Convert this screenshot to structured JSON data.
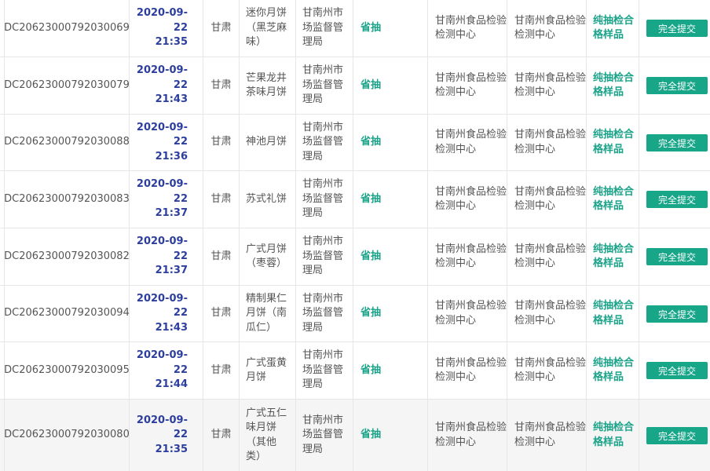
{
  "rows": [
    {
      "id": "DC20623000792030069",
      "date": "2020-09-22",
      "time": "21:35",
      "province": "甘肃",
      "food": "迷你月饼（黑芝麻味）",
      "agency": "甘南州市场监督管理局",
      "type": "省抽",
      "lab1": "甘南州食品检验检测中心",
      "lab2": "甘南州食品检验检测中心",
      "result": "纯抽检合格样品",
      "action": "完全提交"
    },
    {
      "id": "DC20623000792030079",
      "date": "2020-09-22",
      "time": "21:43",
      "province": "甘肃",
      "food": "芒果龙井茶味月饼",
      "agency": "甘南州市场监督管理局",
      "type": "省抽",
      "lab1": "甘南州食品检验检测中心",
      "lab2": "甘南州食品检验检测中心",
      "result": "纯抽检合格样品",
      "action": "完全提交"
    },
    {
      "id": "DC20623000792030088",
      "date": "2020-09-22",
      "time": "21:36",
      "province": "甘肃",
      "food": "神池月饼",
      "agency": "甘南州市场监督管理局",
      "type": "省抽",
      "lab1": "甘南州食品检验检测中心",
      "lab2": "甘南州食品检验检测中心",
      "result": "纯抽检合格样品",
      "action": "完全提交"
    },
    {
      "id": "DC20623000792030083",
      "date": "2020-09-22",
      "time": "21:37",
      "province": "甘肃",
      "food": "苏式礼饼",
      "agency": "甘南州市场监督管理局",
      "type": "省抽",
      "lab1": "甘南州食品检验检测中心",
      "lab2": "甘南州食品检验检测中心",
      "result": "纯抽检合格样品",
      "action": "完全提交"
    },
    {
      "id": "DC20623000792030082",
      "date": "2020-09-22",
      "time": "21:37",
      "province": "甘肃",
      "food": "广式月饼（枣蓉）",
      "agency": "甘南州市场监督管理局",
      "type": "省抽",
      "lab1": "甘南州食品检验检测中心",
      "lab2": "甘南州食品检验检测中心",
      "result": "纯抽检合格样品",
      "action": "完全提交"
    },
    {
      "id": "DC20623000792030094",
      "date": "2020-09-22",
      "time": "21:43",
      "province": "甘肃",
      "food": "精制果仁月饼（南瓜仁）",
      "agency": "甘南州市场监督管理局",
      "type": "省抽",
      "lab1": "甘南州食品检验检测中心",
      "lab2": "甘南州食品检验检测中心",
      "result": "纯抽检合格样品",
      "action": "完全提交"
    },
    {
      "id": "DC20623000792030095",
      "date": "2020-09-22",
      "time": "21:44",
      "province": "甘肃",
      "food": "广式蛋黄月饼",
      "agency": "甘南州市场监督管理局",
      "type": "省抽",
      "lab1": "甘南州食品检验检测中心",
      "lab2": "甘南州食品检验检测中心",
      "result": "纯抽检合格样品",
      "action": "完全提交"
    },
    {
      "id": "DC20623000792030080",
      "date": "2020-09-22",
      "time": "21:35",
      "province": "甘肃",
      "food": "广式五仁味月饼（其他类）",
      "agency": "甘南州市场监督管理局",
      "type": "省抽",
      "lab1": "甘南州食品检验检测中心",
      "lab2": "甘南州食品检验检测中心",
      "result": "纯抽检合格样品",
      "action": "完全提交"
    }
  ],
  "colors": {
    "accent": "#18a689",
    "date": "#2c3e9e",
    "highlight_row": "#f5f5f5"
  }
}
